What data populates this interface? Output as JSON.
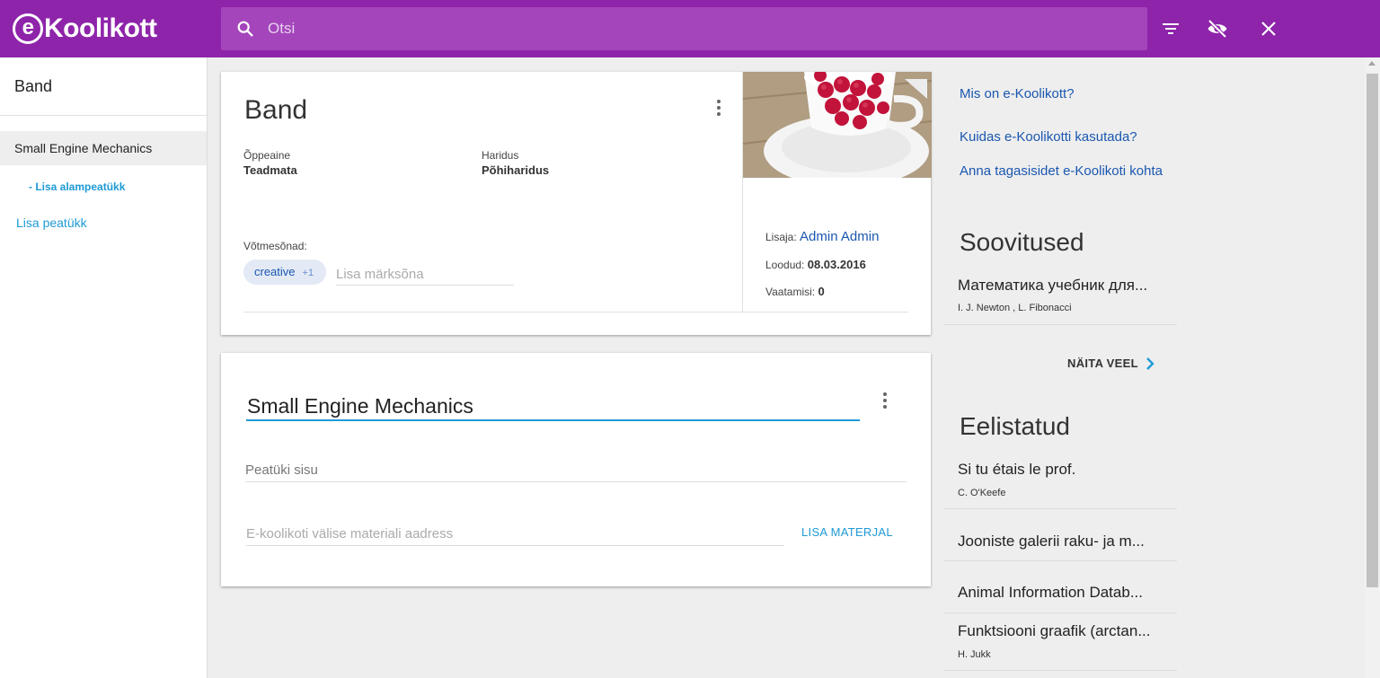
{
  "header": {
    "logo_text": "Koolikott",
    "logo_mark": "e",
    "search_placeholder": "Otsi",
    "icons": [
      "search-icon",
      "filter-icon",
      "eye-off-icon",
      "close-icon"
    ],
    "color": "#8e24aa"
  },
  "sidebar": {
    "title": "Band",
    "items": [
      {
        "label": "Small Engine Mechanics",
        "active": true
      },
      {
        "label": "- Lisa alampeatükk"
      },
      {
        "label": "Lisa peatükk"
      }
    ]
  },
  "material": {
    "title": "Band",
    "subject_label": "Õppeaine",
    "subject_value": "Teadmata",
    "education_label": "Haridus",
    "education_value": "Põhiharidus",
    "keywords_label": "Võtmesõnad:",
    "keyword_chip": "creative",
    "keyword_extra": "+1",
    "keyword_placeholder": "Lisa märksõna",
    "added_by_label": "Lisaja:",
    "added_by_value": "Admin Admin",
    "created_label": "Loodud:",
    "created_value": "08.03.2016",
    "views_label": "Vaatamisi:",
    "views_value": "0"
  },
  "chapter": {
    "title": "Small Engine Mechanics",
    "content_placeholder": "Peatüki sisu",
    "material_placeholder": "E-koolikoti välise materiali aadress",
    "add_material_label": "LISA MATERJAL"
  },
  "right": {
    "links": [
      {
        "label": "Mis on e-Koolikott?"
      },
      {
        "label": "Kuidas e-Koolikotti kasutada?"
      },
      {
        "label": "Anna tagasisidet e-Koolikoti kohta"
      }
    ],
    "recommendations_heading": "Soovitused",
    "recommendations": [
      {
        "title": "Математика учебник для...",
        "author": "I. J. Newton , L. Fibonacci"
      }
    ],
    "show_more_label": "NÄITA VEEL",
    "favorites_heading": "Eelistatud",
    "favorites": [
      {
        "title": "Si tu étais le prof.",
        "author": "C. O'Keefe"
      },
      {
        "title": "Jooniste galerii raku- ja m...",
        "author": ""
      },
      {
        "title": "Animal Information Datab...",
        "author": ""
      },
      {
        "title": "Funktsiooni graafik (arctan...",
        "author": "H. Jukk"
      }
    ]
  },
  "colors": {
    "accent": "#1e9ad6",
    "link": "#1a57b0",
    "purple": "#8e24aa"
  }
}
